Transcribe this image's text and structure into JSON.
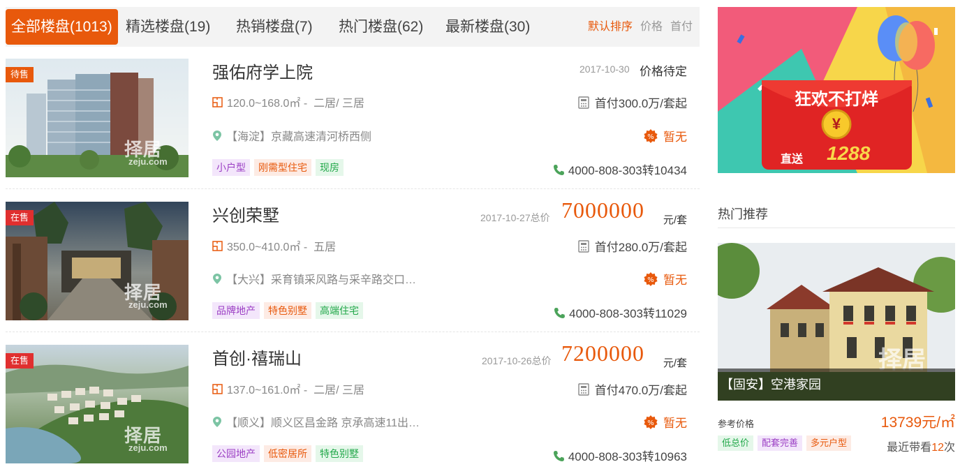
{
  "tabs": [
    {
      "label": "全部楼盘(1013)",
      "active": true
    },
    {
      "label": "精选楼盘(19)"
    },
    {
      "label": "热销楼盘(7)"
    },
    {
      "label": "热门楼盘(62)"
    },
    {
      "label": "最新楼盘(30)"
    }
  ],
  "sort": [
    "默认排序",
    "价格",
    "首付"
  ],
  "watermark": {
    "cn": "择居",
    "en": "zeju.com"
  },
  "listings": [
    {
      "status": "待售",
      "title": "强佑府学上院",
      "date": "2017-10-30",
      "price_text": "价格待定",
      "area": "120.0~168.0㎡ -",
      "layouts": "二居/ 三居",
      "down_payment": "首付300.0万/套起",
      "location": "【海淀】京藏高速清河桥西侧",
      "discount": "暂无",
      "tags": [
        "小户型",
        "刚需型住宅",
        "现房"
      ],
      "phone": "4000-808-303转10434"
    },
    {
      "status": "在售",
      "title": "兴创荣墅",
      "date": "2017-10-27总价",
      "price_big": "7000000",
      "price_unit": "元/套",
      "area": "350.0~410.0㎡ -",
      "layouts": "五居",
      "down_payment": "首付280.0万/套起",
      "location": "【大兴】采育镇采风路与采辛路交口…",
      "discount": "暂无",
      "tags": [
        "品牌地产",
        "特色别墅",
        "高端住宅"
      ],
      "phone": "4000-808-303转11029"
    },
    {
      "status": "在售",
      "title": "首创·禧瑞山",
      "date": "2017-10-26总价",
      "price_big": "7200000",
      "price_unit": "元/套",
      "area": "137.0~161.0㎡ -",
      "layouts": "二居/ 三居",
      "down_payment": "首付470.0万/套起",
      "location": "【顺义】顺义区昌金路 京承高速11出…",
      "discount": "暂无",
      "tags": [
        "公园地产",
        "低密居所",
        "特色别墅"
      ],
      "phone": "4000-808-303转10963"
    }
  ],
  "banner": {
    "headline": "狂欢不打烊",
    "coin": "¥",
    "prefix": "直送",
    "amount": "1288"
  },
  "sidebar": {
    "title": "热门推荐",
    "caption": "【固安】空港家园",
    "ref_label": "参考价格",
    "ref_price": "13739元/㎡",
    "tags": [
      "低总价",
      "配套完善",
      "多元户型"
    ],
    "visits_prefix": "最近带看",
    "visits_count": "12",
    "visits_suffix": "次"
  },
  "colors": {
    "accent": "#e8590c",
    "badge_red": "#e02f2f"
  }
}
